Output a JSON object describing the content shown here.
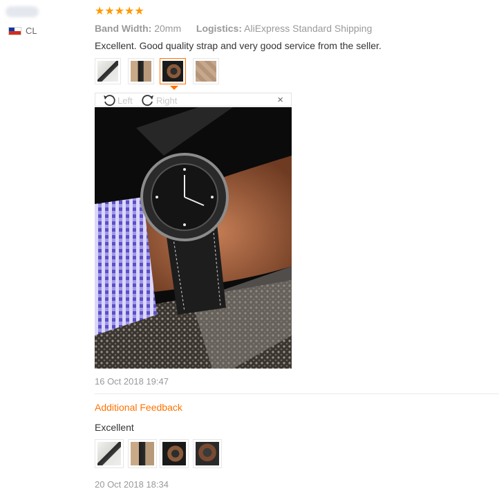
{
  "reviewer": {
    "country_code": "CL"
  },
  "rating": {
    "stars": "★★★★★",
    "value": 5
  },
  "attributes": {
    "band_width_label": "Band Width:",
    "band_width_value": "20mm",
    "logistics_label": "Logistics:",
    "logistics_value": "AliExpress Standard Shipping"
  },
  "review": {
    "text": "Excellent. Good quality strap and very good service from the seller.",
    "date": "16 Oct 2018 19:47"
  },
  "viewer": {
    "rotate_left_label": "Left",
    "rotate_right_label": "Right",
    "close_label": "×"
  },
  "additional_feedback": {
    "title": "Additional Feedback",
    "text": "Excellent",
    "date": "20 Oct 2018 18:34"
  },
  "colors": {
    "accent": "#ff7300",
    "star": "#ff9a00"
  }
}
